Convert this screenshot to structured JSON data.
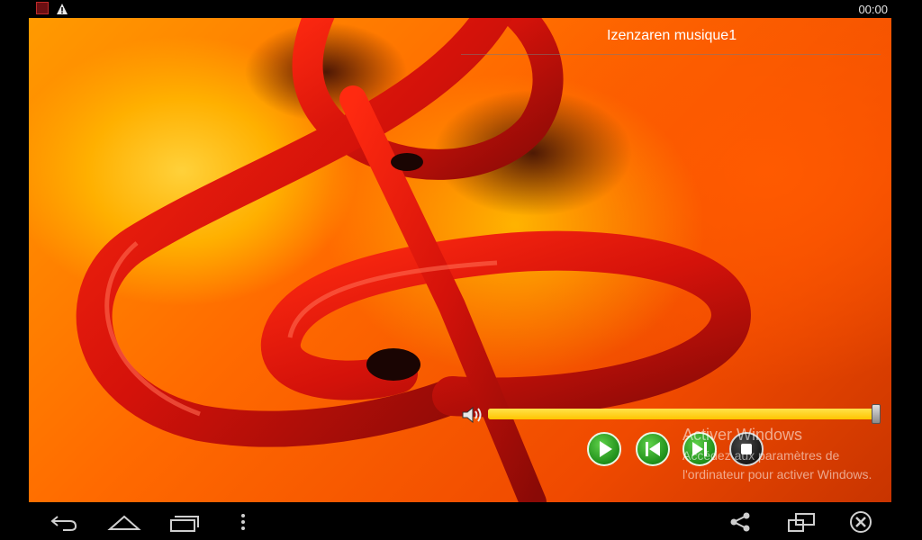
{
  "status_bar": {
    "time": "00:00",
    "notification_icon": "app-notification-icon",
    "warning_icon": "warning-icon"
  },
  "player": {
    "title": "Izenzaren musique1",
    "progress": 1.0,
    "volume_icon": "volume-icon",
    "controls": [
      {
        "name": "play",
        "icon": "play-icon"
      },
      {
        "name": "previous",
        "icon": "skip-previous-icon"
      },
      {
        "name": "next",
        "icon": "skip-next-icon"
      },
      {
        "name": "stop",
        "icon": "stop-icon"
      }
    ]
  },
  "overlay": {
    "activate_title": "Activer Windows",
    "activate_line1": "Accédez aux paramètres de",
    "activate_line2": "l'ordinateur pour activer Windows."
  },
  "navigation": {
    "buttons": [
      "back-icon",
      "home-icon",
      "recent-apps-icon",
      "menu-icon",
      "share-icon",
      "screen-mirror-icon",
      "close-icon"
    ]
  },
  "colors": {
    "seek_bar": "#ffc400",
    "control_green": "#2ea124",
    "background_orange": "#ff6a00"
  }
}
